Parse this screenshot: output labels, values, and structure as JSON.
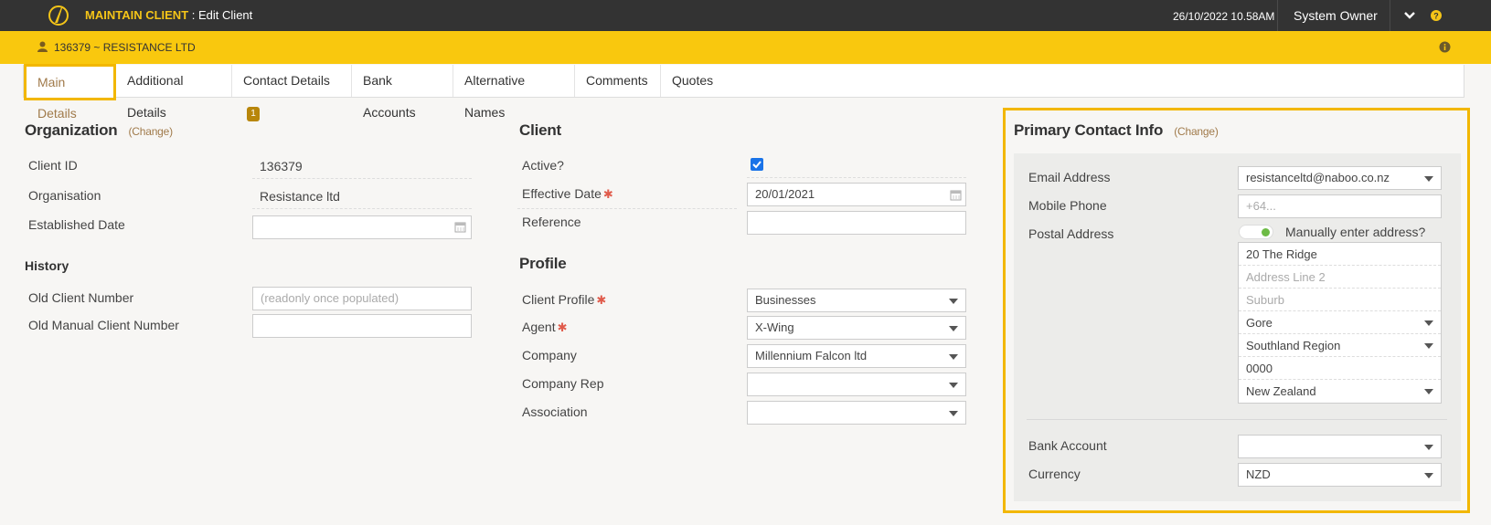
{
  "header": {
    "module": "MAINTAIN CLIENT",
    "separator": ":",
    "page": "Edit Client",
    "datetime": "26/10/2022 10.58AM",
    "user": "System Owner"
  },
  "client_bar": {
    "name": "136379 ~ RESISTANCE LTD"
  },
  "tabs": [
    {
      "label": "Main Details"
    },
    {
      "label": "Additional Details"
    },
    {
      "label": "Contact Details",
      "badge": "1"
    },
    {
      "label": "Bank Accounts"
    },
    {
      "label": "Alternative Names"
    },
    {
      "label": "Comments"
    },
    {
      "label": "Quotes"
    }
  ],
  "organization": {
    "title": "Organization",
    "change": "(Change)",
    "client_id_label": "Client ID",
    "client_id": "136379",
    "organisation_label": "Organisation",
    "organisation": "Resistance ltd",
    "established_label": "Established Date",
    "established": ""
  },
  "history": {
    "title": "History",
    "old_client_label": "Old Client Number",
    "old_client_placeholder": "(readonly once populated)",
    "old_manual_label": "Old Manual Client Number",
    "old_manual": ""
  },
  "client": {
    "title": "Client",
    "active_label": "Active?",
    "active": true,
    "effective_label": "Effective Date",
    "effective": "20/01/2021",
    "reference_label": "Reference",
    "reference": ""
  },
  "profile": {
    "title": "Profile",
    "client_profile_label": "Client Profile",
    "client_profile": "Businesses",
    "agent_label": "Agent",
    "agent": "X-Wing",
    "company_label": "Company",
    "company": "Millennium Falcon ltd",
    "company_rep_label": "Company Rep",
    "company_rep": "",
    "association_label": "Association",
    "association": ""
  },
  "primary_contact": {
    "title": "Primary Contact Info",
    "change": "(Change)",
    "email_label": "Email Address",
    "email": "resistanceltd@naboo.co.nz",
    "mobile_label": "Mobile Phone",
    "mobile_placeholder": "+64...",
    "postal_label": "Postal Address",
    "manual_toggle_label": "Manually enter address?",
    "address_line1": "20 The Ridge",
    "address_line2_placeholder": "Address Line 2",
    "suburb_placeholder": "Suburb",
    "city": "Gore",
    "region": "Southland Region",
    "postcode": "0000",
    "country": "New Zealand",
    "bank_account_label": "Bank Account",
    "bank_account": "",
    "currency_label": "Currency",
    "currency": "NZD"
  },
  "colors": {
    "topbar": "#333333",
    "accent_yellow": "#f9c80e",
    "highlight_border": "#f2b700",
    "link_brown": "#a07a4a",
    "toggle_green": "#6dbb45",
    "required_red": "#e05b4b"
  }
}
